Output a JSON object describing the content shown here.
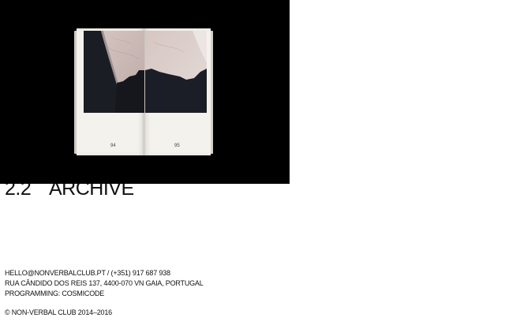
{
  "hero": {
    "image": "open-book-photo",
    "book": {
      "left_page_number": "94",
      "right_page_number": "95"
    }
  },
  "section": {
    "number": "2.2",
    "title": "ARCHIVE"
  },
  "footer": {
    "email": "HELLO@NONVERBALCLUB.PT",
    "separator": " / ",
    "phone": "(+351) 917 687 938",
    "address": "RUA CÂNDIDO DOS REIS 137, 4400-070 VN GAIA, PORTUGAL",
    "programming": "PROGRAMMING: COSMICODE",
    "copyright": "© NON-VERBAL CLUB 2014–2016"
  },
  "colors": {
    "background": "#ffffff",
    "hero_background": "#000000",
    "text": "#111111"
  }
}
